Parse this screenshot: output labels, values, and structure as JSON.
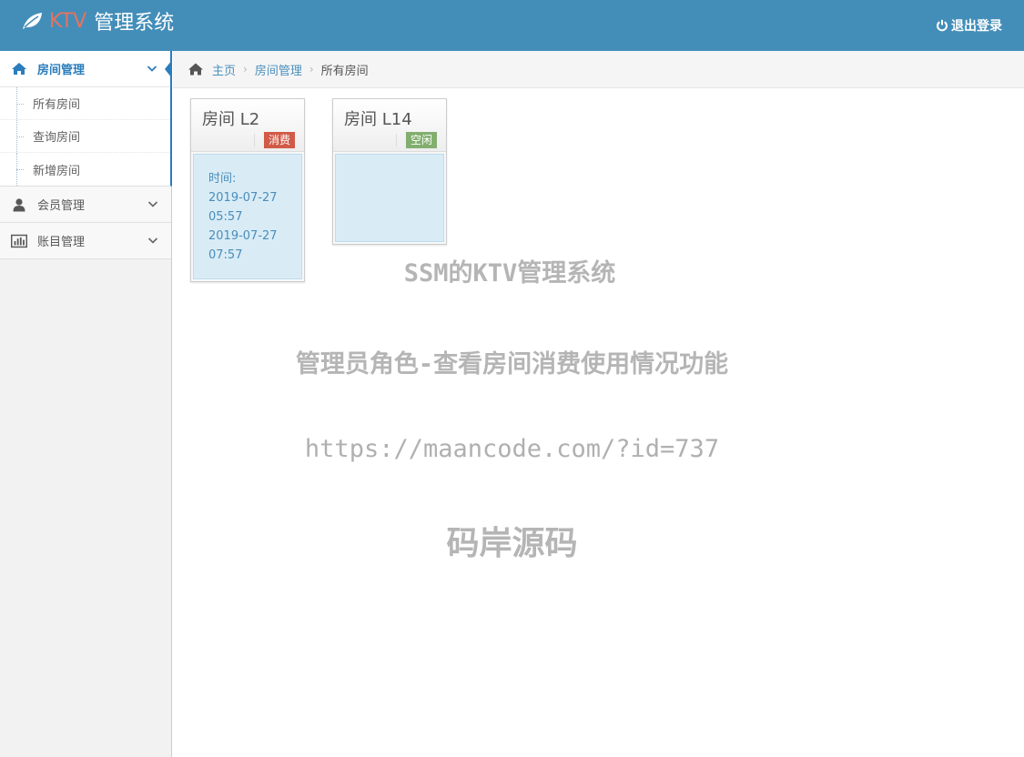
{
  "header": {
    "brand_prefix": "KTV",
    "brand_title": "管理系统",
    "logout_label": "退出登录"
  },
  "sidebar": {
    "groups": [
      {
        "label": "房间管理",
        "icon": "home-icon",
        "expanded": true,
        "items": [
          {
            "label": "所有房间"
          },
          {
            "label": "查询房间"
          },
          {
            "label": "新增房间"
          }
        ]
      },
      {
        "label": "会员管理",
        "icon": "user-icon",
        "expanded": false
      },
      {
        "label": "账目管理",
        "icon": "bar-chart-icon",
        "expanded": false
      }
    ]
  },
  "breadcrumb": {
    "home": "主页",
    "section": "房间管理",
    "current": "所有房间"
  },
  "rooms": [
    {
      "title": "房间 L2",
      "status": "消费",
      "status_color": "#d15b47",
      "time_label": "时间:",
      "start_date": "2019-07-27",
      "start_time": "05:57",
      "end_date": "2019-07-27",
      "end_time": "07:57"
    },
    {
      "title": "房间 L14",
      "status": "空闲",
      "status_color": "#82af6f"
    }
  ],
  "watermark": {
    "line1": "SSM的KTV管理系统",
    "line2": "管理员角色-查看房间消费使用情况功能",
    "line3": "https://maancode.com/?id=737",
    "line4": "码岸源码"
  },
  "colors": {
    "navbar": "#438eb9",
    "brand_accent": "#e5735f",
    "active_link": "#2b7dbc"
  }
}
